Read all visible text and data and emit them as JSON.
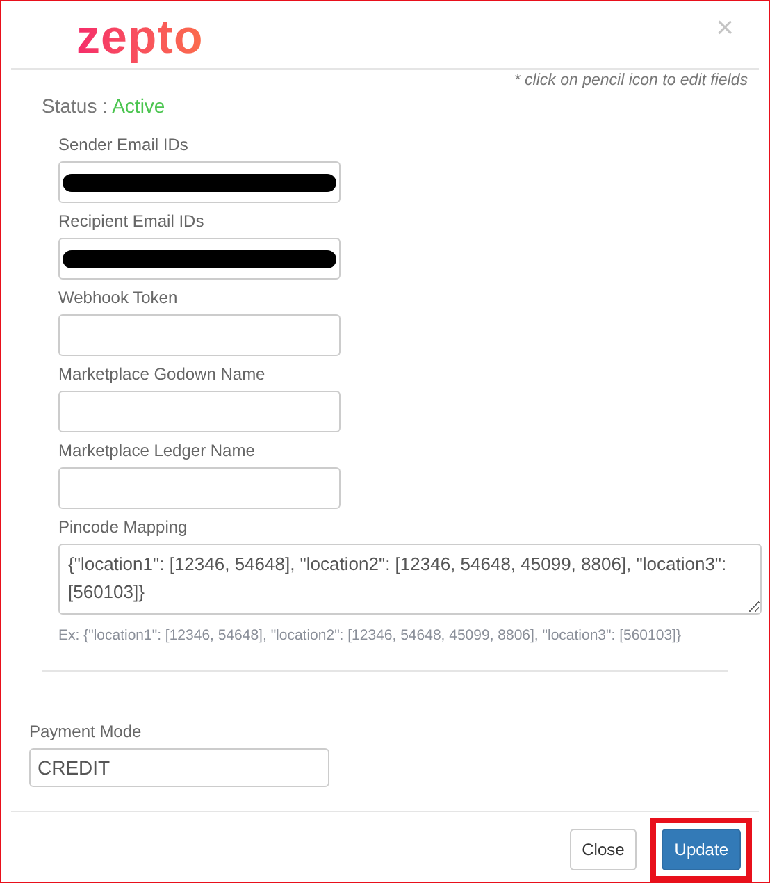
{
  "logo": {
    "text": "zepto"
  },
  "close_icon": "×",
  "hint": "* click on pencil icon to edit fields",
  "status": {
    "label": "Status :",
    "value": "Active"
  },
  "fields": [
    {
      "label": "Sender Email IDs",
      "kind": "input",
      "redacted": true
    },
    {
      "label": "Recipient Email IDs",
      "kind": "input",
      "redacted": true
    },
    {
      "label": "Webhook Token",
      "kind": "input"
    },
    {
      "label": "Marketplace Godown Name",
      "kind": "input"
    },
    {
      "label": "Marketplace Ledger Name",
      "kind": "input"
    },
    {
      "label": "Pincode Mapping",
      "kind": "textarea",
      "value": "{\"location1\": [12346, 54648], \"location2\": [12346, 54648, 45099, 8806], \"location3\": [560103]}",
      "help": "Ex: {\"location1\": [12346, 54648], \"location2\": [12346, 54648, 45099, 8806], \"location3\": [560103]}"
    }
  ],
  "payment_mode": {
    "label": "Payment Mode",
    "value": "CREDIT"
  },
  "buttons": [
    {
      "label": "Close",
      "kind": "default"
    },
    {
      "label": "Update",
      "kind": "primary",
      "highlighted": true
    }
  ]
}
